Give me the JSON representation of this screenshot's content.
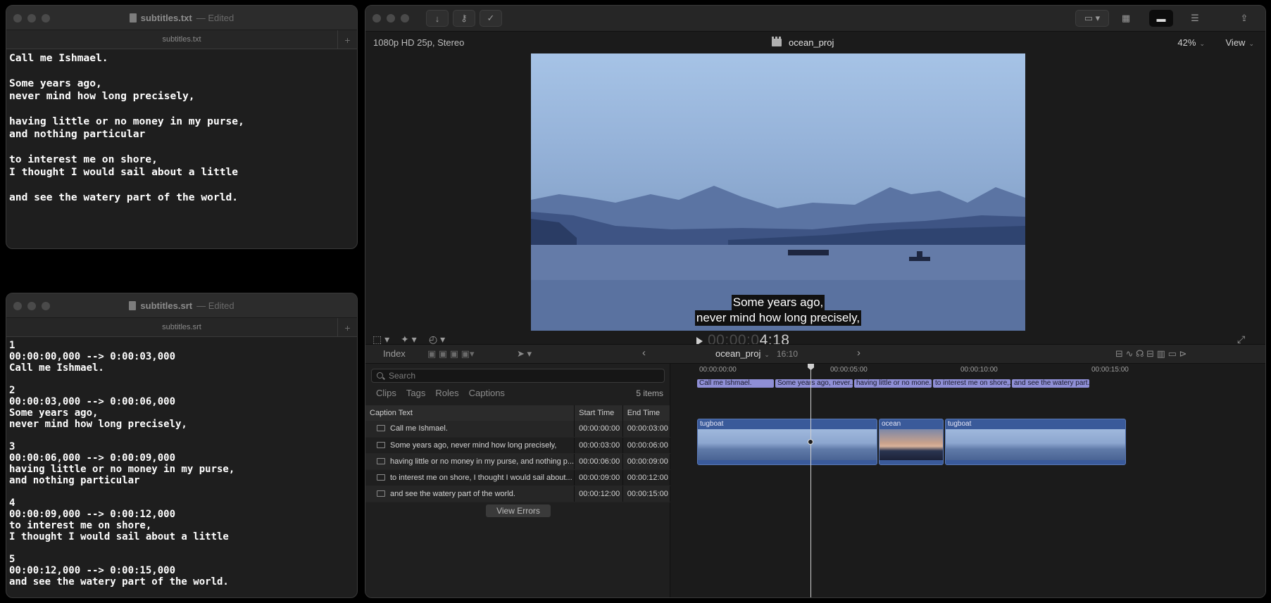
{
  "txt_window": {
    "title": "subtitles.txt",
    "edited": "— Edited",
    "tab": "subtitles.txt",
    "content": "Call me Ishmael.\n\nSome years ago,\nnever mind how long precisely,\n\nhaving little or no money in my purse,\nand nothing particular\n\nto interest me on shore,\nI thought I would sail about a little\n\nand see the watery part of the world."
  },
  "srt_window": {
    "title": "subtitles.srt",
    "edited": "— Edited",
    "tab": "subtitles.srt",
    "content": "1\n00:00:00,000 --> 0:00:03,000\nCall me Ishmael.\n\n2\n00:00:03,000 --> 0:00:06,000\nSome years ago,\nnever mind how long precisely,\n\n3\n00:00:06,000 --> 0:00:09,000\nhaving little or no money in my purse,\nand nothing particular\n\n4\n00:00:09,000 --> 0:00:12,000\nto interest me on shore,\nI thought I would sail about a little\n\n5\n00:00:12,000 --> 0:00:15,000\nand see the watery part of the world."
  },
  "fcp": {
    "format": "1080p HD 25p, Stereo",
    "project": "ocean_proj",
    "zoom": "42%",
    "view_menu": "View",
    "caption_line1": "Some years ago,",
    "caption_line2": "never mind how long precisely,",
    "timecode_dim": "00:00:0",
    "timecode_bright": "4:18",
    "index_button": "Index",
    "timeline_project": "ocean_proj",
    "timeline_duration": "16:10",
    "search_placeholder": "Search",
    "filters": [
      "Clips",
      "Tags",
      "Roles",
      "Captions"
    ],
    "item_count": "5 items",
    "table_headers": [
      "Caption Text",
      "Start Time",
      "End Time"
    ],
    "captions": [
      {
        "text": "Call me Ishmael.",
        "start": "00:00:00:00",
        "end": "00:00:03:00"
      },
      {
        "text": "Some years ago, never mind how long precisely,",
        "start": "00:00:03:00",
        "end": "00:00:06:00"
      },
      {
        "text": "having little or no money in my purse, and nothing p...",
        "start": "00:00:06:00",
        "end": "00:00:09:00"
      },
      {
        "text": "to interest me on shore, I thought I would sail about...",
        "start": "00:00:09:00",
        "end": "00:00:12:00"
      },
      {
        "text": "and see the watery part of the world.",
        "start": "00:00:12:00",
        "end": "00:00:15:00"
      }
    ],
    "view_errors": "View Errors",
    "ruler": [
      "00:00:00:00",
      "00:00:05:00",
      "00:00:10:00",
      "00:00:15:00"
    ],
    "caption_lane": [
      "Call me Ishmael.",
      "Some years ago, never...",
      "having little or no mone...",
      "to interest me on shore,...",
      "and see the watery part..."
    ],
    "clips": [
      "tugboat",
      "ocean",
      "tugboat"
    ]
  }
}
